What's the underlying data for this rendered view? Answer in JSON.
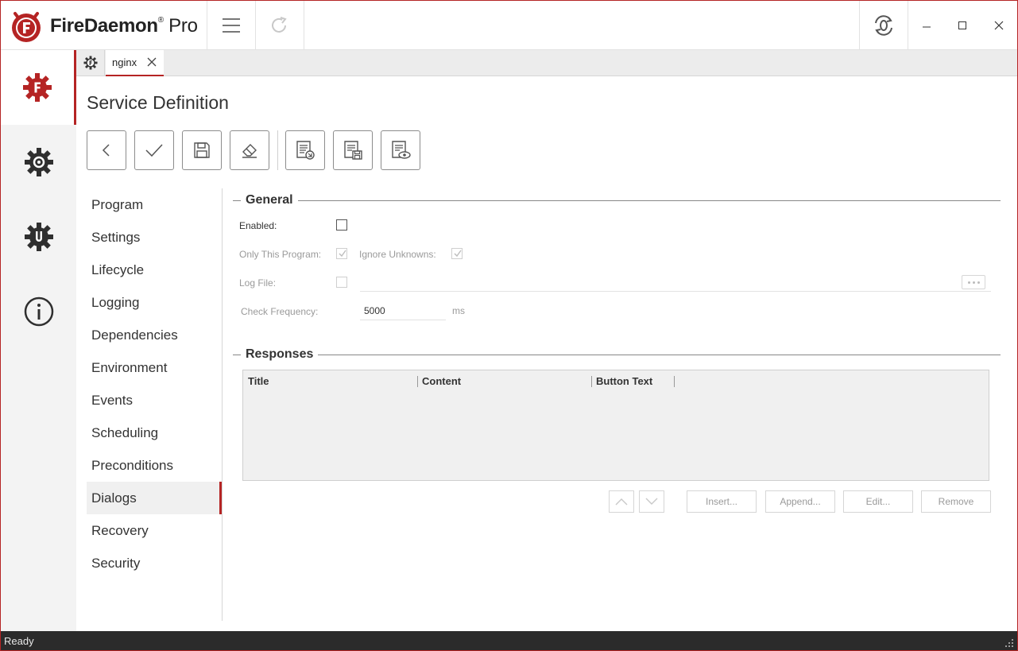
{
  "app": {
    "brand_bold": "FireDaemon",
    "brand_reg": "®",
    "brand_suffix": "Pro",
    "accent": "#b52424"
  },
  "titlebar": {
    "menu_icon": "hamburger-icon",
    "refresh_icon": "redo-icon",
    "service_toggle_icon": "service-refresh-icon",
    "minimize_icon": "minimize-icon",
    "maximize_icon": "maximize-icon",
    "close_icon": "close-icon"
  },
  "rail": [
    {
      "icon": "firedaemon-gear-icon",
      "active": true
    },
    {
      "icon": "settings-gear-icon",
      "active": false
    },
    {
      "icon": "update-gear-icon",
      "active": false
    },
    {
      "icon": "info-icon",
      "active": false
    }
  ],
  "tabs": {
    "home_icon": "firedaemon-tab-icon",
    "active_tab": "nginx",
    "close_label": "close-icon"
  },
  "page": {
    "title": "Service Definition"
  },
  "toolbar": [
    {
      "icon": "back-icon"
    },
    {
      "icon": "check-icon"
    },
    {
      "icon": "save-icon"
    },
    {
      "icon": "eraser-icon"
    },
    {
      "icon": "import-doc-icon"
    },
    {
      "icon": "save-doc-icon"
    },
    {
      "icon": "view-doc-icon"
    }
  ],
  "nav": {
    "items": [
      "Program",
      "Settings",
      "Lifecycle",
      "Logging",
      "Dependencies",
      "Environment",
      "Events",
      "Scheduling",
      "Preconditions",
      "Dialogs",
      "Recovery",
      "Security"
    ],
    "active": "Dialogs"
  },
  "general": {
    "heading": "General",
    "enabled_label": "Enabled:",
    "enabled_checked": false,
    "only_this_program_label": "Only This Program:",
    "only_this_program_checked": true,
    "ignore_unknowns_label": "Ignore Unknowns:",
    "ignore_unknowns_checked": true,
    "log_file_label": "Log File:",
    "log_file_checked": false,
    "log_file_value": "",
    "check_frequency_label": "Check Frequency:",
    "check_frequency_value": "5000",
    "check_frequency_unit": "ms"
  },
  "responses": {
    "heading": "Responses",
    "columns": [
      "Title",
      "Content",
      "Button Text"
    ],
    "rows": [],
    "buttons": {
      "insert": "Insert...",
      "append": "Append...",
      "edit": "Edit...",
      "remove": "Remove"
    }
  },
  "status": {
    "text": "Ready"
  }
}
